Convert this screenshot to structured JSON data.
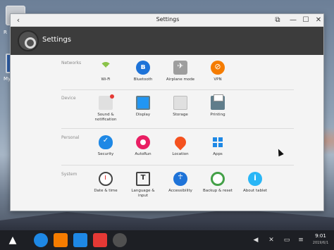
{
  "desktop": {
    "items": [
      {
        "label": "R"
      },
      {
        "label": "My"
      }
    ]
  },
  "window": {
    "title": "Settings",
    "controls": {
      "back": "‹",
      "restore": "⧉",
      "minimize": "—",
      "maximize": "☐",
      "close": "✕"
    }
  },
  "header": {
    "title": "Settings"
  },
  "sections": [
    {
      "label": "Networks",
      "items": [
        {
          "label": "Wi-Fi",
          "icon": "wifi-icon"
        },
        {
          "label": "Bluetooth",
          "icon": "bluetooth-icon"
        },
        {
          "label": "Airplane mode",
          "icon": "airplane-icon"
        },
        {
          "label": "VPN",
          "icon": "vpn-icon"
        }
      ]
    },
    {
      "label": "Device",
      "items": [
        {
          "label": "Sound &\nnotification",
          "icon": "sound-icon"
        },
        {
          "label": "Display",
          "icon": "display-icon"
        },
        {
          "label": "Storage",
          "icon": "storage-icon"
        },
        {
          "label": "Printing",
          "icon": "printer-icon"
        }
      ]
    },
    {
      "label": "Personal",
      "items": [
        {
          "label": "Security",
          "icon": "shield-icon"
        },
        {
          "label": "AutoRun",
          "icon": "autorun-icon"
        },
        {
          "label": "Location",
          "icon": "location-pin-icon"
        },
        {
          "label": "Apps",
          "icon": "apps-grid-icon"
        }
      ]
    },
    {
      "label": "System",
      "items": [
        {
          "label": "Date & time",
          "icon": "clock-icon"
        },
        {
          "label": "Language &\ninput",
          "icon": "language-icon"
        },
        {
          "label": "Accessibility",
          "icon": "accessibility-icon"
        },
        {
          "label": "Backup & reset",
          "icon": "backup-icon"
        },
        {
          "label": "About tablet",
          "icon": "info-icon"
        }
      ]
    }
  ],
  "taskbar": {
    "time": "9:01",
    "date": "2019/6/1",
    "apps": [
      {
        "name": "browser-icon",
        "color": "#1e88e5"
      },
      {
        "name": "files-icon",
        "color": "#f57c00"
      },
      {
        "name": "mail-icon",
        "color": "#1e88e5"
      },
      {
        "name": "office-icon",
        "color": "#e53935"
      },
      {
        "name": "settings-icon",
        "color": "#505050"
      }
    ]
  }
}
